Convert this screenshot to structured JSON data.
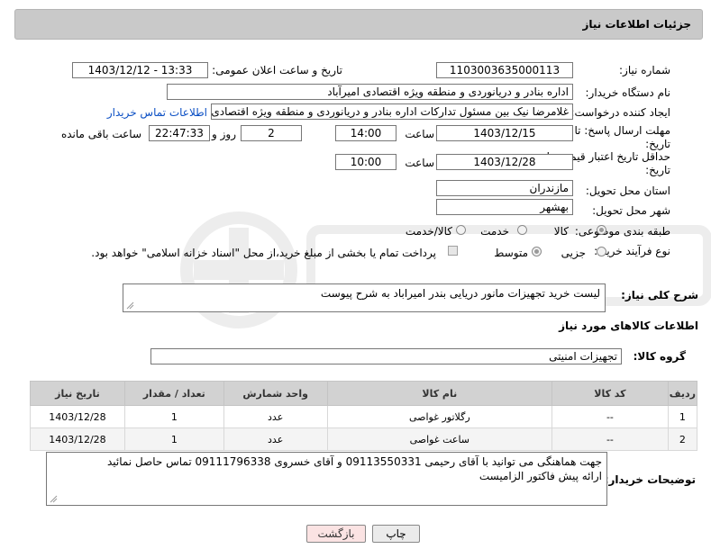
{
  "header": {
    "title": "جزئیات اطلاعات نیاز"
  },
  "fields": {
    "need_number_label": "شماره نیاز:",
    "need_number": "1103003635000113",
    "announce_label": "تاریخ و ساعت اعلان عمومی:",
    "announce_value": "1403/12/12 - 13:33",
    "buyer_org_label": "نام دستگاه خریدار:",
    "buyer_org": "اداره بنادر و دریانوردی و منطقه ویژه اقتصادی امیرآباد",
    "requester_label": "ایجاد کننده درخواست:",
    "requester": "غلامرضا نیک بین مسئول تدارکات اداره بنادر و دریانوردی و منطقه ویژه اقتصادی امیرآباد",
    "buyer_contact_link": "اطلاعات تماس خریدار",
    "reply_deadline_label_1": "مهلت ارسال پاسخ: تا",
    "reply_deadline_label_2": "تاریخ:",
    "reply_date": "1403/12/15",
    "time_label": "ساعت",
    "reply_time": "14:00",
    "days_value": "2",
    "days_label": "روز و",
    "remaining_time": "22:47:33",
    "remaining_label": "ساعت باقی مانده",
    "validity_label_1": "حداقل تاریخ اعتبار قیمت: تا",
    "validity_label_2": "تاریخ:",
    "validity_date": "1403/12/28",
    "validity_time": "10:00",
    "province_label": "استان محل تحویل:",
    "province": "مازندران",
    "city_label": "شهر محل تحویل:",
    "city": "بهشهر",
    "category_label": "طبقه بندی موضوعی:",
    "category_options": [
      "کالا",
      "خدمت",
      "کالا/خدمت"
    ],
    "process_label": "نوع فرآیند خرید :",
    "process_options": [
      "جزیی",
      "متوسط"
    ],
    "payment_note": "پرداخت تمام یا بخشی از مبلغ خرید،از محل \"اسناد خزانه اسلامی\" خواهد بود."
  },
  "description": {
    "label": "شرح کلی نیاز:",
    "text": "لیست خرید تجهیزات مانور دریایی بندر امیراباد به شرح پیوست"
  },
  "goods": {
    "section_title": "اطلاعات کالاهای مورد نیاز",
    "group_label": "گروه کالا:",
    "group_value": "تجهیزات امنیتی",
    "columns": [
      "ردیف",
      "کد کالا",
      "نام کالا",
      "واحد شمارش",
      "تعداد / مقدار",
      "تاریخ نیاز"
    ],
    "rows": [
      [
        "1",
        "--",
        "رگلاتور غواصی",
        "عدد",
        "1",
        "1403/12/28"
      ],
      [
        "2",
        "--",
        "ساعت غواصی",
        "عدد",
        "1",
        "1403/12/28"
      ]
    ]
  },
  "buyer_notes": {
    "label": "توضیحات خریدار:",
    "line1": "جهت هماهنگی می توانید با  آقای رحیمی 09113550331 و آقای خسروی 09111796338 تماس حاصل نمائید",
    "line2": "ارائه پیش فاکتور الزامیست"
  },
  "buttons": {
    "print": "چاپ",
    "back": "بازگشت"
  },
  "colors": {
    "header_bg": "#c9c9c9",
    "link": "#0b4fc4",
    "table_header": "#d2d2d2",
    "back_btn": "#fbe3e3"
  }
}
